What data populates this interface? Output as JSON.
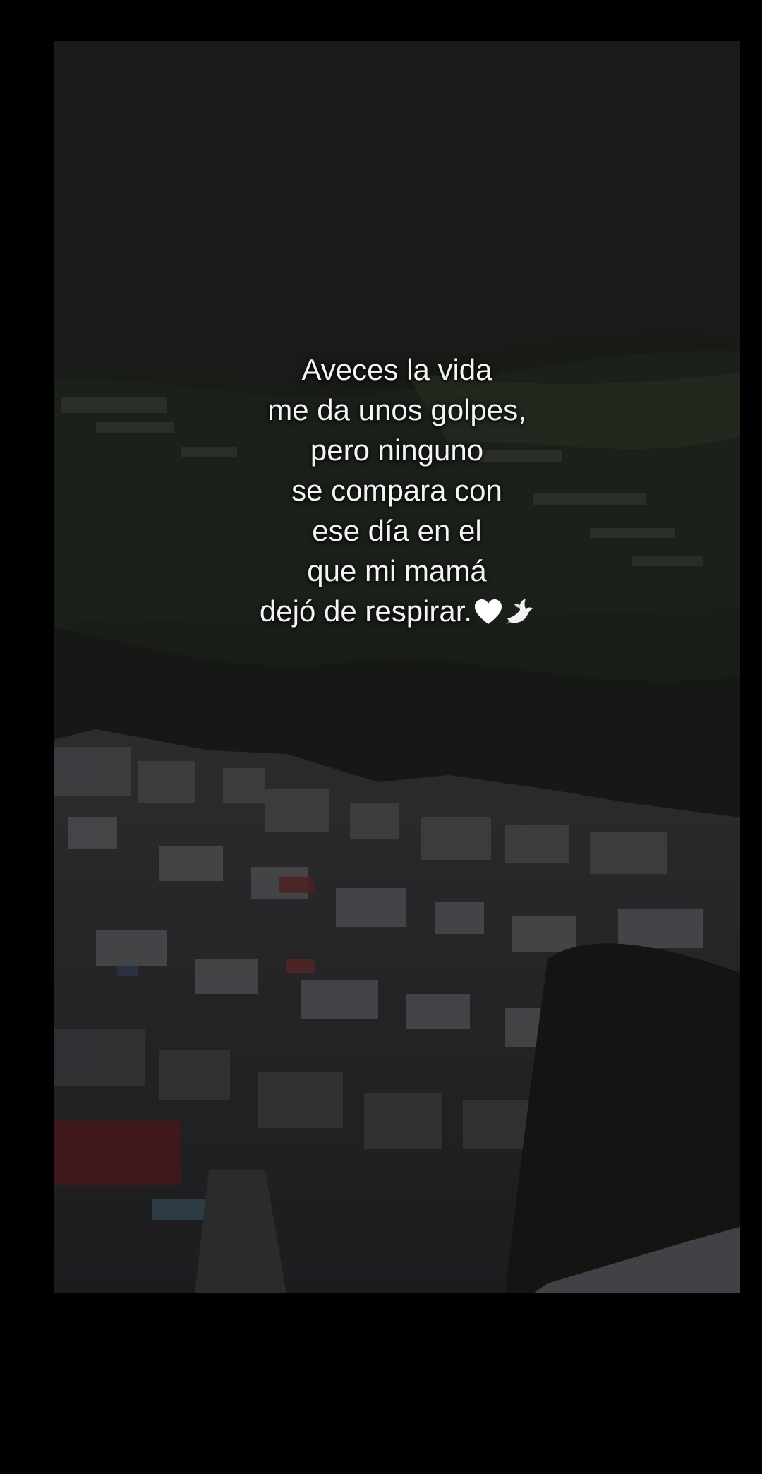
{
  "caption": {
    "lines": [
      "Aveces la vida",
      "me da unos golpes,",
      "pero ninguno",
      "se compara con",
      "ese día en el",
      "que mi mamá",
      "dejó de respirar."
    ],
    "emojis": [
      "white-heart-icon",
      "dove-icon"
    ]
  },
  "colors": {
    "background": "#000000",
    "text": "#f4f4f4",
    "mountain": "#1e231d",
    "roof_red": "#7a2a2a"
  }
}
